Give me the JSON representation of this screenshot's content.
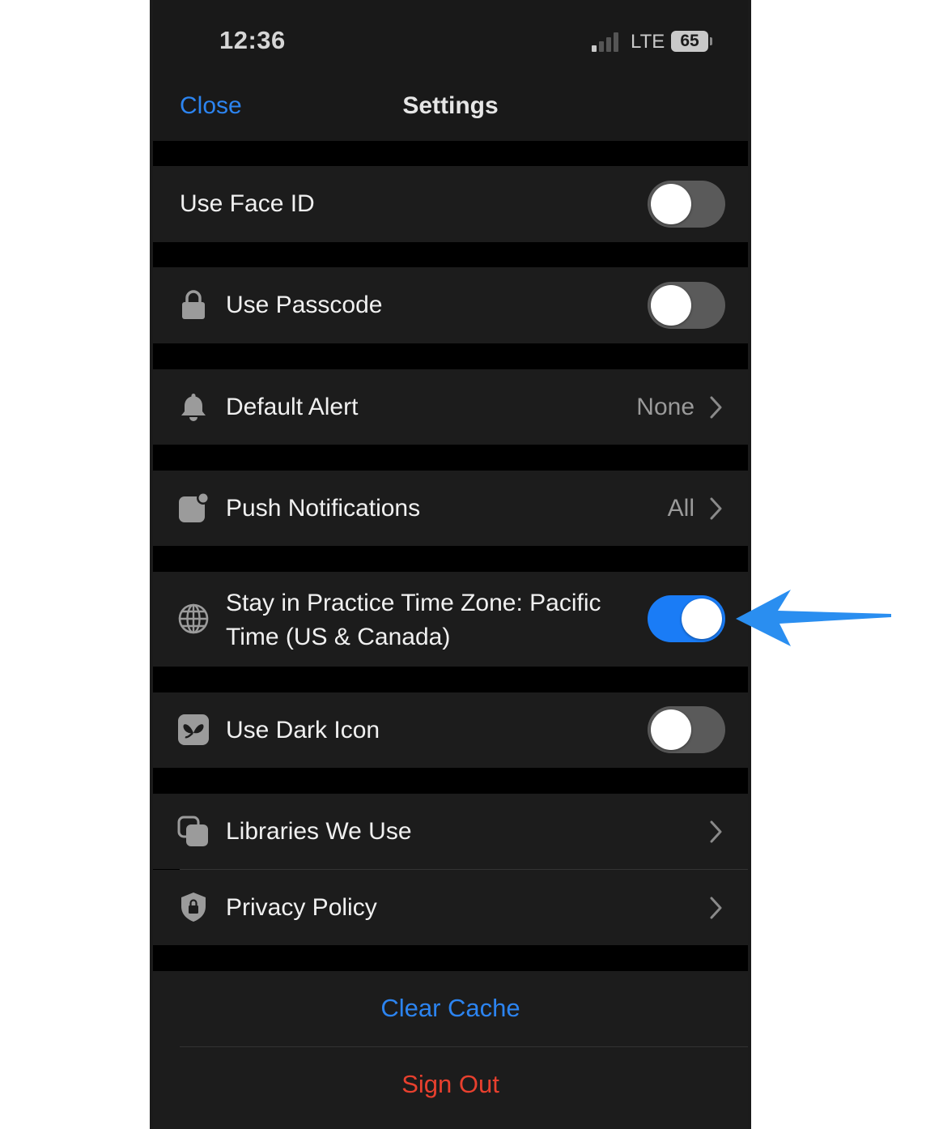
{
  "status_bar": {
    "time": "12:36",
    "network": "LTE",
    "battery": "65"
  },
  "nav": {
    "close_label": "Close",
    "title": "Settings"
  },
  "rows": {
    "face_id": {
      "label": "Use Face ID",
      "on": false
    },
    "passcode": {
      "label": "Use Passcode",
      "on": false
    },
    "default_alert": {
      "label": "Default Alert",
      "value": "None"
    },
    "push": {
      "label": "Push Notifications",
      "value": "All"
    },
    "timezone": {
      "label_line1": "Stay in Practice Time Zone: Pacific",
      "label_line2": "Time (US & Canada)",
      "on": true
    },
    "dark_icon": {
      "label": "Use Dark Icon",
      "on": false
    },
    "libraries": {
      "label": "Libraries We Use"
    },
    "privacy": {
      "label": "Privacy Policy"
    }
  },
  "actions": {
    "clear_cache": "Clear Cache",
    "sign_out": "Sign Out"
  },
  "colors": {
    "accent": "#2c84f0",
    "destructive": "#e8402e",
    "toggle_on": "#1a7cf6",
    "annotation_arrow": "#2a8ef0"
  },
  "icons": [
    "lock-icon",
    "bell-icon",
    "notification-badge-icon",
    "globe-icon",
    "butterfly-app-icon",
    "stacked-squares-icon",
    "shield-lock-icon",
    "chevron-right-icon",
    "annotation-arrow"
  ]
}
